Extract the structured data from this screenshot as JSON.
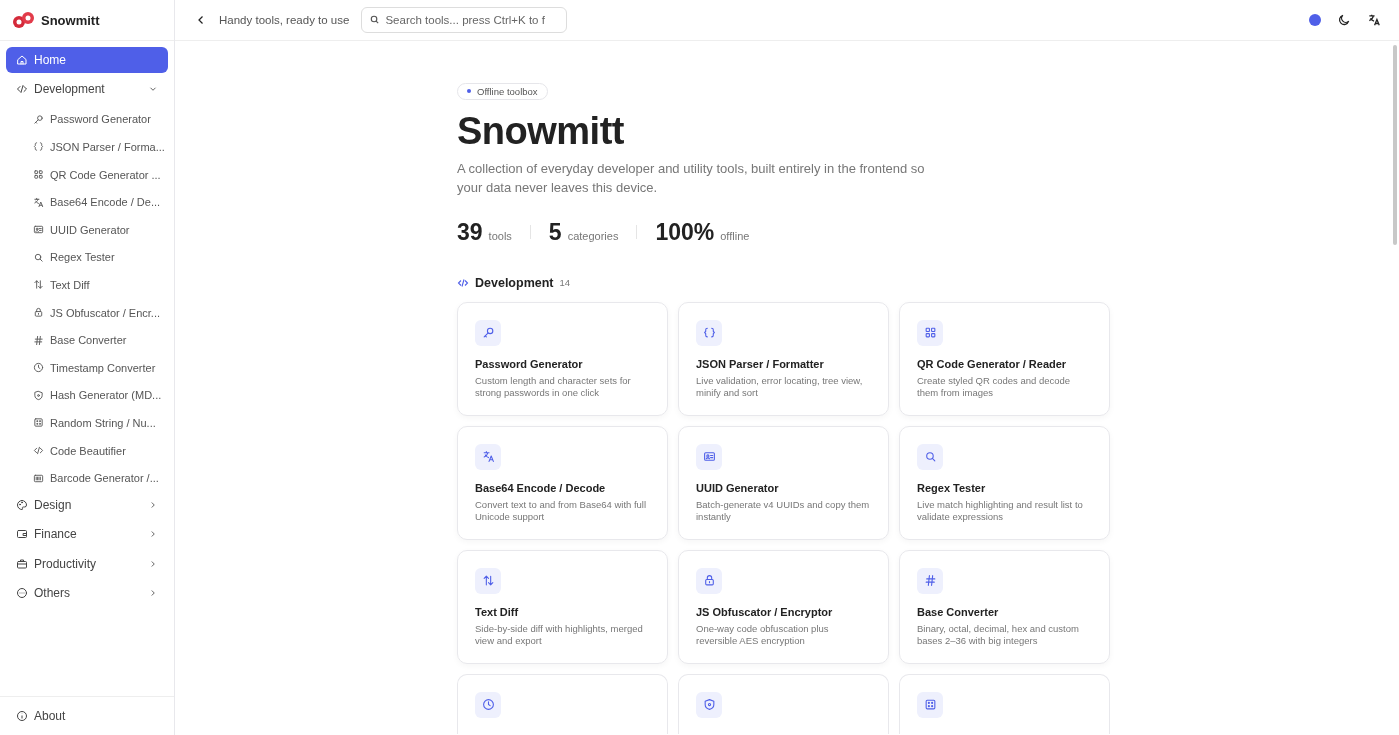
{
  "brand": {
    "name": "Snowmitt"
  },
  "sidebar": {
    "items": [
      {
        "label": "Home",
        "kind": "link",
        "selected": true
      },
      {
        "label": "Development",
        "kind": "group",
        "expanded": true,
        "selected": false,
        "children": [
          {
            "label": "Password Generator",
            "selected": false
          },
          {
            "label": "JSON Parser / Forma...",
            "selected": false
          },
          {
            "label": "QR Code Generator ...",
            "selected": false
          },
          {
            "label": "Base64 Encode / De...",
            "selected": false
          },
          {
            "label": "UUID Generator",
            "selected": false
          },
          {
            "label": "Regex Tester",
            "selected": false
          },
          {
            "label": "Text Diff",
            "selected": false
          },
          {
            "label": "JS Obfuscator / Encr...",
            "selected": false
          },
          {
            "label": "Base Converter",
            "selected": false
          },
          {
            "label": "Timestamp Converter",
            "selected": false
          },
          {
            "label": "Hash Generator (MD...",
            "selected": false
          },
          {
            "label": "Random String / Nu...",
            "selected": false
          },
          {
            "label": "Code Beautifier",
            "selected": false
          },
          {
            "label": "Barcode Generator /...",
            "selected": false
          }
        ]
      },
      {
        "label": "Design",
        "kind": "group",
        "expanded": false,
        "selected": false
      },
      {
        "label": "Finance",
        "kind": "group",
        "expanded": false,
        "selected": false
      },
      {
        "label": "Productivity",
        "kind": "group",
        "expanded": false,
        "selected": false
      },
      {
        "label": "Others",
        "kind": "group",
        "expanded": false,
        "selected": false
      }
    ],
    "footer": {
      "label": "About"
    }
  },
  "header": {
    "tagline": "Handy tools, ready to use",
    "search": {
      "placeholder": "Search tools... press Ctrl+K to f"
    }
  },
  "hero": {
    "badge": "Offline toolbox",
    "title": "Snowmitt",
    "description": "A collection of everyday developer and utility tools, built entirely in the frontend so your data never leaves this device.",
    "stats": [
      {
        "value": "39",
        "label": "tools"
      },
      {
        "value": "5",
        "label": "categories"
      },
      {
        "value": "100%",
        "label": "offline"
      }
    ]
  },
  "section": {
    "title": "Development",
    "count": "14",
    "cards": [
      {
        "title": "Password Generator",
        "description": "Custom length and character sets for strong passwords in one click"
      },
      {
        "title": "JSON Parser / Formatter",
        "description": "Live validation, error locating, tree view, minify and sort"
      },
      {
        "title": "QR Code Generator / Reader",
        "description": "Create styled QR codes and decode them from images"
      },
      {
        "title": "Base64 Encode / Decode",
        "description": "Convert text to and from Base64 with full Unicode support"
      },
      {
        "title": "UUID Generator",
        "description": "Batch-generate v4 UUIDs and copy them instantly"
      },
      {
        "title": "Regex Tester",
        "description": "Live match highlighting and result list to validate expressions"
      },
      {
        "title": "Text Diff",
        "description": "Side-by-side diff with highlights, merged view and export"
      },
      {
        "title": "JS Obfuscator / Encryptor",
        "description": "One-way code obfuscation plus reversible AES encryption"
      },
      {
        "title": "Base Converter",
        "description": "Binary, octal, decimal, hex and custom bases 2–36 with big integers"
      },
      {
        "kind": "partial"
      },
      {
        "kind": "partial"
      },
      {
        "kind": "partial"
      }
    ]
  }
}
